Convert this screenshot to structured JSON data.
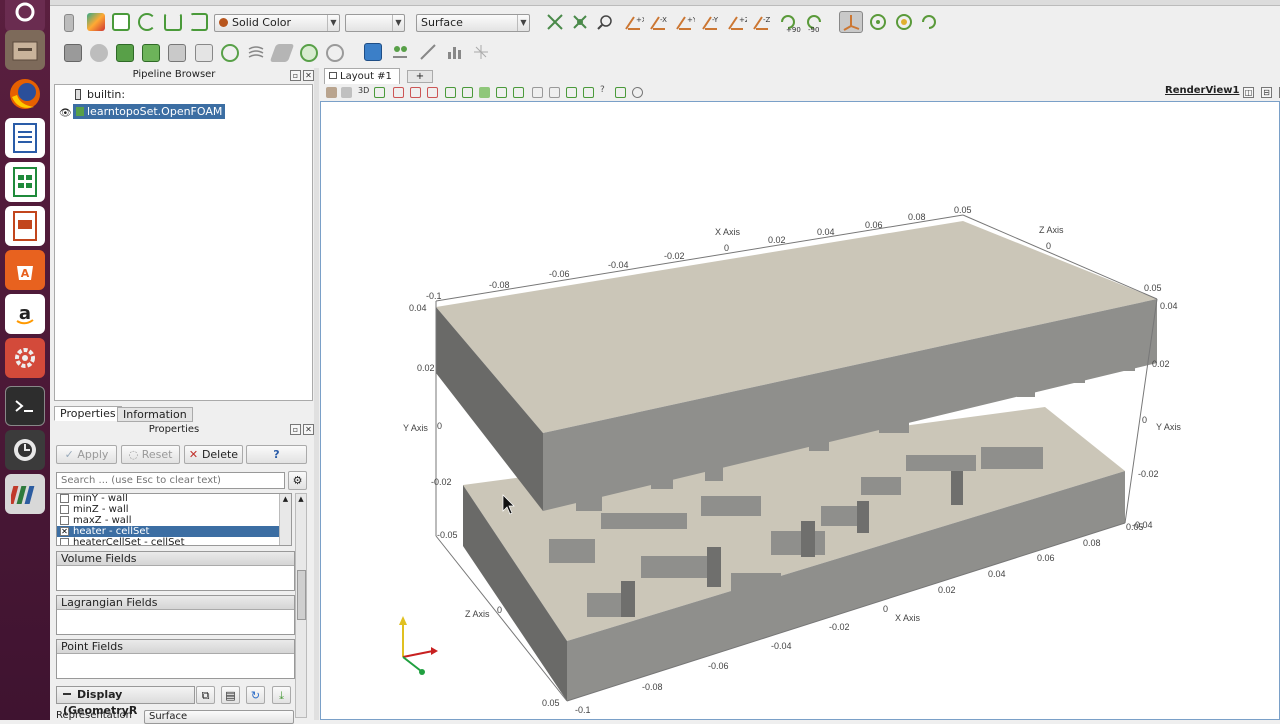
{
  "launcher": {
    "apps": [
      "ubuntu-icon",
      "files-icon",
      "firefox-icon",
      "writer-icon",
      "calc-icon",
      "impress-icon",
      "software-center-icon",
      "amazon-icon",
      "settings-icon",
      "terminal-icon",
      "updater-icon",
      "paraview-icon"
    ]
  },
  "toolbar": {
    "color_by": "Solid Color",
    "color_component": "",
    "representation": "Surface",
    "rotate_plus90": "+90",
    "rotate_minus90": "-90"
  },
  "pipeline": {
    "title": "Pipeline Browser",
    "root": "builtin:",
    "source": "learntopoSet.OpenFOAM"
  },
  "tabs": {
    "properties": "Properties",
    "information": "Information"
  },
  "properties": {
    "title": "Properties",
    "apply": "Apply",
    "reset": "Reset",
    "delete": "Delete",
    "help": "?",
    "search_placeholder": "Search ... (use Esc to clear text)",
    "mesh_regions": [
      {
        "label": "minY - wall",
        "checked": false,
        "selected": false
      },
      {
        "label": "minZ - wall",
        "checked": false,
        "selected": false
      },
      {
        "label": "maxZ - wall",
        "checked": false,
        "selected": false
      },
      {
        "label": "heater - cellSet",
        "checked": true,
        "selected": true
      },
      {
        "label": "heaterCellSet - cellSet",
        "checked": false,
        "selected": false
      }
    ],
    "volume_fields": "Volume Fields",
    "lagrangian_fields": "Lagrangian Fields",
    "point_fields": "Point Fields",
    "display_label": "Display (GeometryR",
    "representation_label": "Representation",
    "representation_value": "Surface"
  },
  "layout": {
    "tab_label": "Layout #1",
    "close_glyph": "✕",
    "add_tab": "+",
    "view_name": "RenderView1",
    "view_3d": "3D"
  },
  "axes": {
    "x_title": "X Axis",
    "y_title": "Y Axis",
    "z_title": "Z Axis",
    "top_x_ticks": [
      "-0.1",
      "-0.08",
      "-0.06",
      "-0.04",
      "-0.02",
      "0",
      "0.02",
      "0.04",
      "0.06",
      "0.08",
      "0.05"
    ],
    "top_z_ticks": [
      "0",
      "0.05"
    ],
    "left_y_ticks": [
      "0.04",
      "0.02",
      "0",
      "-0.02",
      "-0.05"
    ],
    "right_y_ticks": [
      "0.04",
      "0.02",
      "0",
      "-0.02",
      "-0.04"
    ],
    "bottom_x_ticks": [
      "0.08",
      "0.06",
      "0.04",
      "0.02",
      "0",
      "-0.02",
      "-0.04",
      "-0.06",
      "-0.08",
      "-0.1"
    ],
    "bottom_z_ticks": [
      "0.05",
      "0"
    ],
    "right_x_end": "0.05"
  },
  "colors": {
    "selection": "#3c6ea3",
    "surface_light": "#cbc6b8",
    "surface_mid": "#8f8f8c",
    "surface_dark": "#6a6a68",
    "launcher": "#4a1936"
  }
}
